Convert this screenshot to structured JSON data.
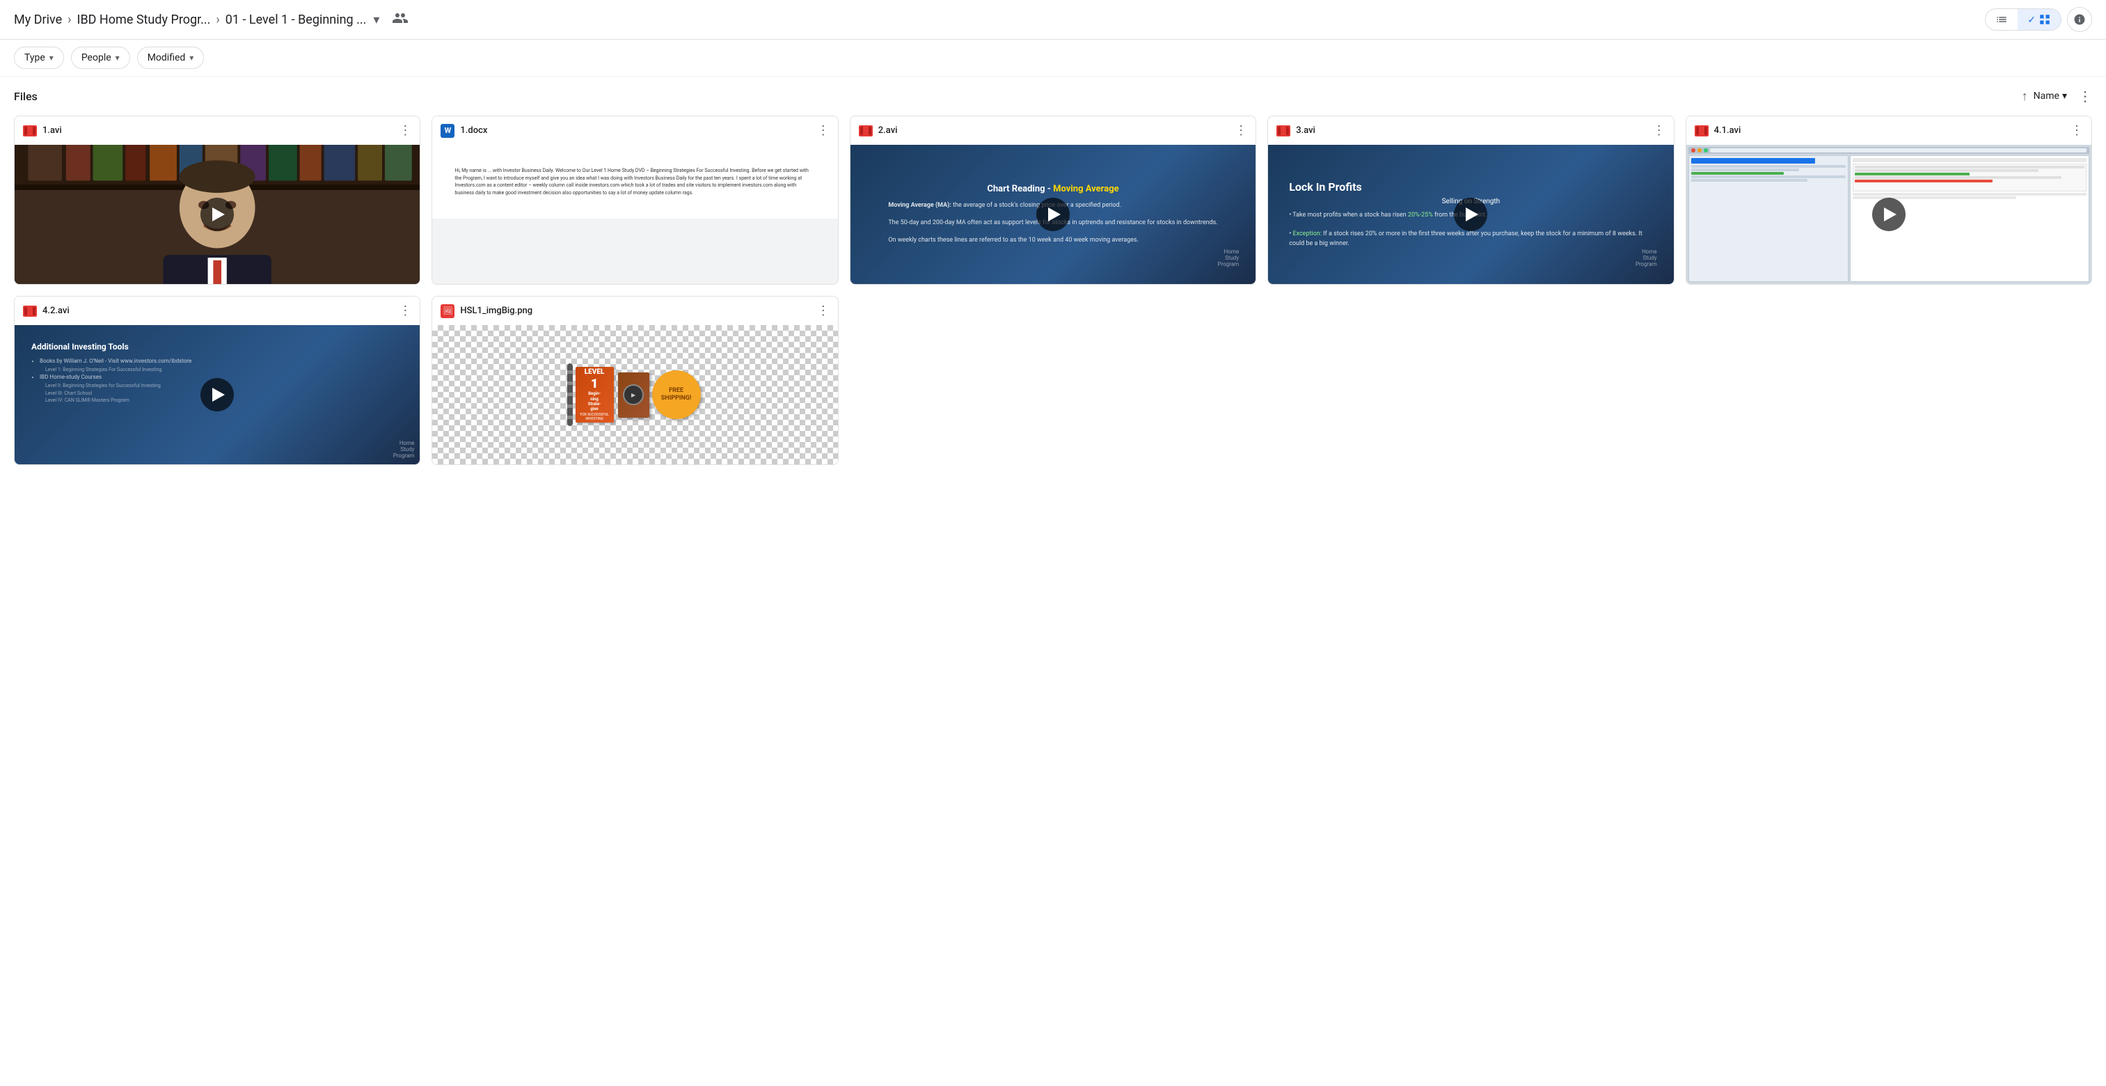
{
  "breadcrumb": {
    "my_drive": "My Drive",
    "ibd_folder": "IBD Home Study Progr...",
    "current_folder": "01 - Level 1 - Beginning ...",
    "separator": "›"
  },
  "filters": {
    "type_label": "Type",
    "people_label": "People",
    "modified_label": "Modified"
  },
  "files_section": {
    "title": "Files",
    "sort_label": "Name"
  },
  "toolbar": {
    "list_icon": "☰",
    "grid_icon": "⊞",
    "check_icon": "✓",
    "info_icon": "ℹ"
  },
  "files": [
    {
      "name": "1.avi",
      "type": "avi",
      "icon": "film"
    },
    {
      "name": "1.docx",
      "type": "docx",
      "icon": "word",
      "doc_preview": "Hi, My name is ... with Investor Business Daily. Welcome to Our Level 1 Home Study DVD – Beginning Strategies For Successful Investing. Before we get started with the Program, I want to introduce myself and give you an idea what I was doing before coming to work at Investors Business Daily for the past ten years. I spent a lot of time working at Investors.com as a content editor – weekly column call inside investors.com which took a lot of trades and site visitors to implement investors.com along with business daily to make good investment decision also opportunities to say a lot of money update column rags."
    },
    {
      "name": "2.avi",
      "type": "avi",
      "icon": "film",
      "thumb_title": "Chart Reading - Moving Average",
      "thumb_highlight": "Moving Average",
      "thumb_body": "Moving Average (MA): the average of a stock's closing price over a specified period.\n\nThe 50-day and 200-day MA often act as support levels for stocks in uptrends and resistance for stocks in downtrends.\n\nOn weekly charts these lines are referred to as the 10 week and 40 week moving averages."
    },
    {
      "name": "3.avi",
      "type": "avi",
      "icon": "film",
      "thumb_title": "Lock In Profits",
      "thumb_subtitle": "Selling on Strength",
      "thumb_bullets": [
        "Take most profits when a stock has risen 20%-25% from the buy point.",
        "Exception: If a stock rises 20% or more in the first three weeks after you purchase, keep the stock for a minimum of 8 weeks. It could be a big winner."
      ]
    },
    {
      "name": "4.1.avi",
      "type": "avi",
      "icon": "film"
    },
    {
      "name": "4.2.avi",
      "type": "avi",
      "icon": "film",
      "thumb_title": "Additional Investing Tools",
      "thumb_bullets": [
        "Books by William J. O'Neil - Visit www.investors.com/ibdstore",
        "IBD Home-study Courses"
      ]
    },
    {
      "name": "HSL1_imgBig.png",
      "type": "png",
      "icon": "image",
      "badge_text": "FREE\nSHIPPING!",
      "book_text": "Beginning\nStrategies\nFOR SUCCESSFUL INVESTING"
    }
  ]
}
